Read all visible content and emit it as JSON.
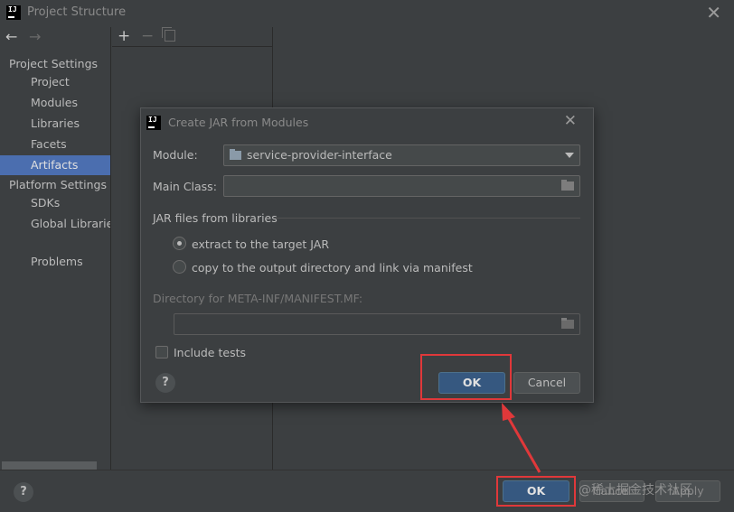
{
  "window": {
    "title": "Project Structure",
    "logo": "IJ"
  },
  "sidebar": {
    "project_settings": "Project Settings",
    "items_project": [
      "Project",
      "Modules",
      "Libraries",
      "Facets",
      "Artifacts"
    ],
    "platform_settings": "Platform Settings",
    "items_platform": [
      "SDKs",
      "Global Libraries"
    ],
    "problems": "Problems",
    "selected": "Artifacts"
  },
  "toolbar": {
    "add_icon": "plus-icon",
    "remove_icon": "minus-icon",
    "copy_icon": "copy-icon"
  },
  "footer": {
    "help": "?",
    "ok": "OK",
    "cancel": "Cancel",
    "apply": "Apply"
  },
  "dialog": {
    "title": "Create JAR from Modules",
    "logo": "IJ",
    "module_label": "Module:",
    "module_value": "service-provider-interface",
    "main_class_label": "Main Class:",
    "main_class_value": "",
    "jar_section": "JAR files from libraries",
    "option_extract": "extract to the target JAR",
    "option_copy": "copy to the output directory and link via manifest",
    "selected_option": "extract",
    "manifest_dir_label": "Directory for META-INF/MANIFEST.MF:",
    "manifest_dir_value": "",
    "include_tests": "Include tests",
    "include_tests_checked": false,
    "help": "?",
    "ok": "OK",
    "cancel": "Cancel"
  },
  "watermark": "@稀土掘金技术社区",
  "colors": {
    "background": "#3c3f41",
    "selection": "#4b6eaf",
    "default_button": "#365880",
    "annotation": "#e0383a"
  }
}
